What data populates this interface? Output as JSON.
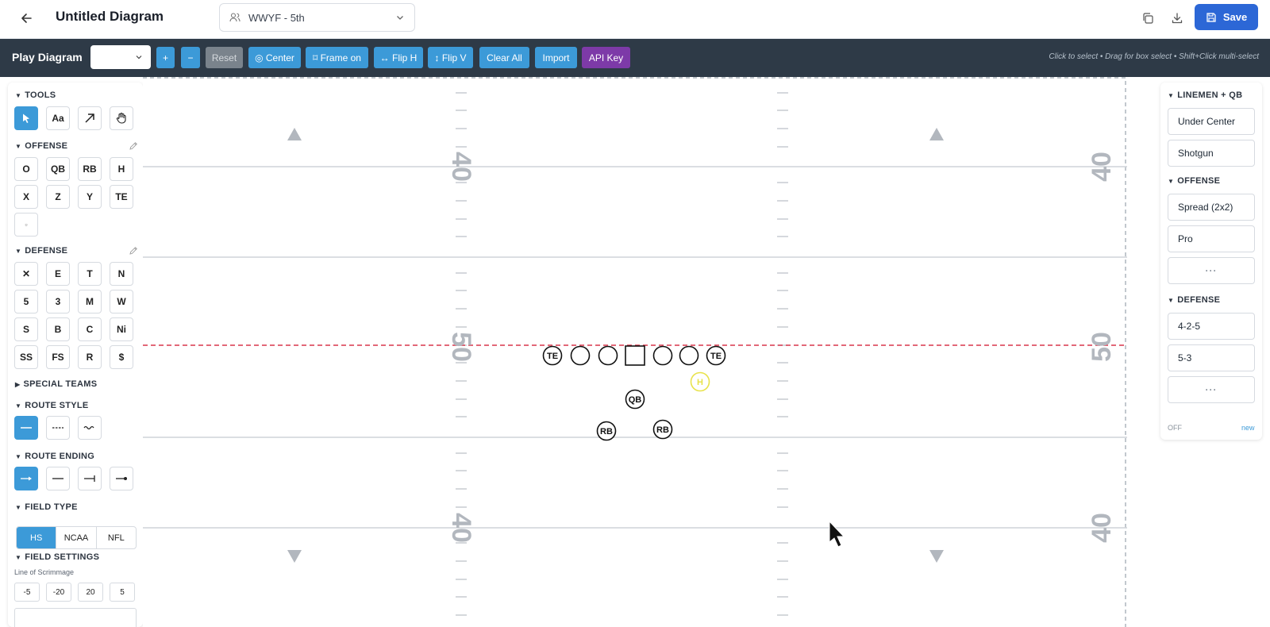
{
  "header": {
    "title": "Untitled Diagram",
    "team": "WWYF - 5th",
    "save_label": "Save"
  },
  "toolbar": {
    "title": "Play Diagram",
    "select_value": "",
    "buttons": [
      "+",
      "−",
      "Reset",
      "◎ Center",
      "⌑ Frame on",
      "↔ Flip H",
      "↕ Flip V",
      "Clear All",
      "Import",
      "API Key"
    ],
    "hint": "Click to select • Drag for box select • Shift+Click multi-select"
  },
  "left": {
    "tools_title": "TOOLS",
    "tools": [
      "arrow-cursor",
      "Aa",
      "arrow-draw",
      "hand"
    ],
    "offense_title": "OFFENSE",
    "offense": [
      "O",
      "QB",
      "RB",
      "H",
      "X",
      "Z",
      "Y",
      "TE",
      "▫"
    ],
    "defense_title": "DEFENSE",
    "defense": [
      "✕",
      "E",
      "T",
      "N",
      "5",
      "3",
      "M",
      "W",
      "S",
      "B",
      "C",
      "Ni",
      "SS",
      "FS",
      "R",
      "$"
    ],
    "special_title": "SPECIAL TEAMS",
    "route_style_title": "ROUTE STYLE",
    "route_ending_title": "ROUTE ENDING",
    "field_type_title": "FIELD TYPE",
    "field_types": [
      "HS",
      "NCAA",
      "NFL"
    ],
    "field_type_selected": "HS",
    "field_settings_title": "FIELD SETTINGS",
    "los_label": "Line of Scrimmage",
    "los_buttons": [
      "-5",
      "-20",
      "20",
      "5"
    ]
  },
  "field": {
    "yard_numbers": [
      "40",
      "50",
      "40"
    ],
    "players": [
      {
        "label": "TE",
        "shape": "circle"
      },
      {
        "label": "",
        "shape": "circle"
      },
      {
        "label": "",
        "shape": "circle"
      },
      {
        "label": "",
        "shape": "square"
      },
      {
        "label": "",
        "shape": "circle"
      },
      {
        "label": "",
        "shape": "circle"
      },
      {
        "label": "TE",
        "shape": "circle"
      },
      {
        "label": "H",
        "shape": "circle",
        "color": "#e8e24a"
      },
      {
        "label": "QB",
        "shape": "circle"
      },
      {
        "label": "RB",
        "shape": "circle"
      },
      {
        "label": "RB",
        "shape": "circle"
      }
    ],
    "los_color": "#d9364c"
  },
  "right": {
    "sections": [
      {
        "title": "LINEMEN + QB",
        "items": [
          "Under Center",
          "Shotgun"
        ]
      },
      {
        "title": "OFFENSE",
        "items": [
          "Spread (2x2)",
          "Pro",
          "···"
        ]
      },
      {
        "title": "DEFENSE",
        "items": [
          "4-2-5",
          "5-3",
          "···"
        ]
      }
    ],
    "off_label": "OFF",
    "new_label": "new"
  },
  "colors": {
    "accent": "#3c9ad8",
    "save": "#2c67d6",
    "toolbar": "#2e3a47",
    "api_key": "#7d3aa8"
  }
}
